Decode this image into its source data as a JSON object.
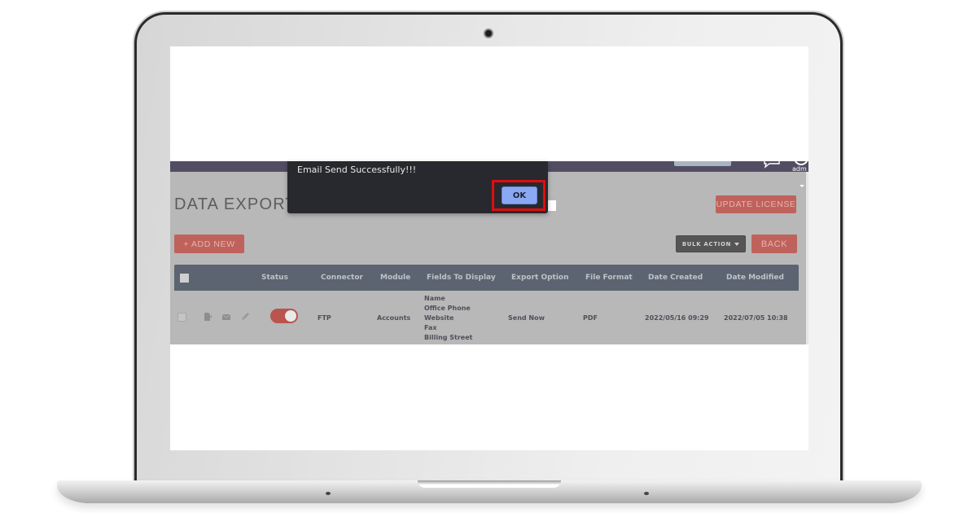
{
  "device": {
    "type": "laptop-mockup"
  },
  "app": {
    "topbar": {
      "user_label": "adm",
      "icons": [
        "chat-icon",
        "user-icon"
      ]
    },
    "page_title": "DATA EXPORT",
    "buttons": {
      "update_license": "UPDATE LICENSE",
      "add_new": "+ ADD NEW",
      "bulk_action": "BULK ACTION",
      "back": "BACK"
    },
    "table": {
      "columns": [
        "Status",
        "Connector",
        "Module",
        "Fields To Display",
        "Export Option",
        "File Format",
        "Date Created",
        "Date Modified"
      ],
      "rows": [
        {
          "row_icons": [
            "export-file-icon",
            "email-icon",
            "edit-pencil-icon"
          ],
          "status_enabled": true,
          "connector": "FTP",
          "module": "Accounts",
          "fields": [
            "Name",
            "Office Phone",
            "Website",
            "Fax",
            "Billing Street"
          ],
          "export_option": "Send Now",
          "file_format": "PDF",
          "date_created": "2022/05/16 09:29",
          "date_modified": "2022/07/05 10:38"
        }
      ]
    }
  },
  "dialog": {
    "message": "Email Send Successfully!!!",
    "ok_label": "OK",
    "highlight_color": "#e00d0d"
  },
  "colors": {
    "accent_red": "#c0625c",
    "topbar": "#534d64",
    "table_header": "#5b6470",
    "dialog_bg": "#28292e",
    "ok_button": "#8aa9f5"
  }
}
